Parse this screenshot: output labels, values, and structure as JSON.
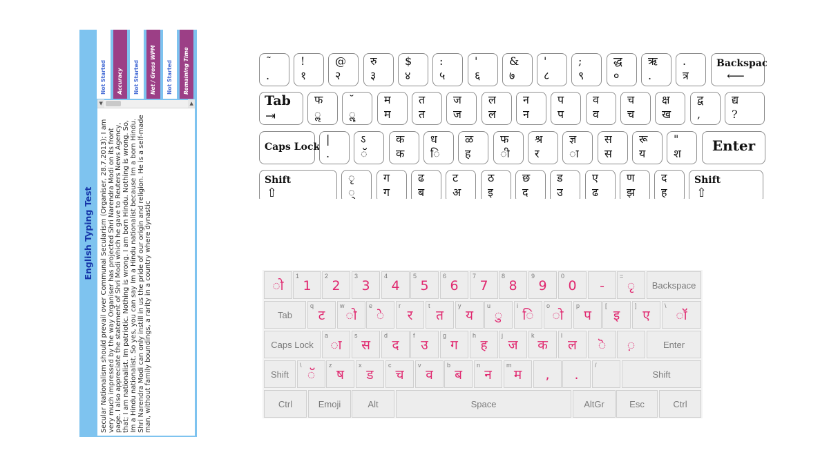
{
  "typing_test": {
    "title": "English Typing Test",
    "passage": "Secular Nationalism should prevail over Communal Secularism (Organiser, 28.7.2013); I am very much impressed by the way Organiser has projected Shri Narendra Modi on its front page. I also appreciate the statement of Shri Modi which he gave to Reuters News Agency, that; I am nationalist. Im patriotic. Nothing is wrong. I am born Hindu. Nothing is wrong. So, Im a Hindu nationalist. So yes, you can say Im a Hindu nationalist because Im a born Hindu. Shri Narendra Modi can only instill in us the pride of our origin and religion. He is a self-made man, without family boundings, a rarity in a country where dynastic",
    "stats": [
      {
        "label": "Remaining Time",
        "value": "Not Started"
      },
      {
        "label": "Net / Gross WPM",
        "value": "Not Started"
      },
      {
        "label": "Accuracy",
        "value": "Not Started"
      }
    ]
  },
  "keyboard_kruti": {
    "rows": [
      [
        {
          "top": "˜",
          "bottom": "."
        },
        {
          "top": "!",
          "bottom": "१"
        },
        {
          "top": "@",
          "bottom": "२"
        },
        {
          "top": "रु",
          "bottom": "३"
        },
        {
          "top": "$",
          "bottom": "४"
        },
        {
          "top": ":",
          "bottom": "५"
        },
        {
          "top": "'",
          "bottom": "६"
        },
        {
          "top": "&",
          "bottom": "७"
        },
        {
          "top": "'",
          "bottom": "८"
        },
        {
          "top": ";",
          "bottom": "९"
        },
        {
          "top": "द्ध",
          "bottom": "०"
        },
        {
          "top": "ऋ",
          "bottom": "."
        },
        {
          "top": ".",
          "bottom": "त्र"
        },
        {
          "word": "Backspace"
        }
      ],
      [
        {
          "word": "Tab"
        },
        {
          "top": "फ",
          "bottom": "ॢ"
        },
        {
          "top": "˘",
          "bottom": "ॣ"
        },
        {
          "top": "म",
          "bottom": "म"
        },
        {
          "top": "त",
          "bottom": "त"
        },
        {
          "top": "ज",
          "bottom": "ज"
        },
        {
          "top": "ल",
          "bottom": "ल"
        },
        {
          "top": "न",
          "bottom": "न"
        },
        {
          "top": "प",
          "bottom": "प"
        },
        {
          "top": "व",
          "bottom": "व"
        },
        {
          "top": "च",
          "bottom": "च"
        },
        {
          "top": "क्ष",
          "bottom": "ख"
        },
        {
          "top": "द्व",
          "bottom": ","
        },
        {
          "top": "द्य",
          "bottom": "?"
        }
      ],
      [
        {
          "word": "Caps Lock"
        },
        {
          "top": "|",
          "bottom": "."
        },
        {
          "top": "ऽ",
          "bottom": "ॅ"
        },
        {
          "top": "क",
          "bottom": "क"
        },
        {
          "top": "ध",
          "bottom": "ि"
        },
        {
          "top": "ळ",
          "bottom": "ह"
        },
        {
          "top": "फ",
          "bottom": "ी"
        },
        {
          "top": "श्र",
          "bottom": "र"
        },
        {
          "top": "ज्ञ",
          "bottom": "ा"
        },
        {
          "top": "स",
          "bottom": "स"
        },
        {
          "top": "रू",
          "bottom": "य"
        },
        {
          "top": "\"",
          "bottom": "श"
        },
        {
          "word": "Enter"
        }
      ],
      [
        {
          "word": "Shift"
        },
        {
          "top": "ृ",
          "bottom": "्"
        },
        {
          "top": "ग",
          "bottom": "ग"
        },
        {
          "top": "ढ",
          "bottom": "ब"
        },
        {
          "top": "ट",
          "bottom": "अ"
        },
        {
          "top": "ठ",
          "bottom": "इ"
        },
        {
          "top": "छ",
          "bottom": "द"
        },
        {
          "top": "ड",
          "bottom": "उ"
        },
        {
          "top": "ए",
          "bottom": "ढ"
        },
        {
          "top": "ण",
          "bottom": "झ"
        },
        {
          "top": "द",
          "bottom": "ह"
        },
        {
          "word": "Shift"
        }
      ]
    ]
  },
  "keyboard_osk": {
    "rows": [
      [
        {
          "s": "",
          "m": "ो"
        },
        {
          "s": "1",
          "m": "1"
        },
        {
          "s": "2",
          "m": "2"
        },
        {
          "s": "3",
          "m": "3"
        },
        {
          "s": "4",
          "m": "4"
        },
        {
          "s": "5",
          "m": "5"
        },
        {
          "s": "6",
          "m": "6"
        },
        {
          "s": "7",
          "m": "7"
        },
        {
          "s": "8",
          "m": "8"
        },
        {
          "s": "9",
          "m": "9"
        },
        {
          "s": "0",
          "m": "0"
        },
        {
          "s": "",
          "m": "-"
        },
        {
          "s": "=",
          "m": "ृ"
        },
        {
          "label": "Backspace"
        }
      ],
      [
        {
          "label": "Tab"
        },
        {
          "s": "q",
          "m": "ट"
        },
        {
          "s": "w",
          "m": "ो"
        },
        {
          "s": "e",
          "m": "े"
        },
        {
          "s": "r",
          "m": "र"
        },
        {
          "s": "t",
          "m": "त"
        },
        {
          "s": "y",
          "m": "य"
        },
        {
          "s": "u",
          "m": "ु"
        },
        {
          "s": "i",
          "m": "ि"
        },
        {
          "s": "o",
          "m": "ो"
        },
        {
          "s": "p",
          "m": "प"
        },
        {
          "s": "[",
          "m": "इ"
        },
        {
          "s": "]",
          "m": "ए"
        },
        {
          "s": "\\",
          "m": "ॉ"
        }
      ],
      [
        {
          "label": "Caps Lock"
        },
        {
          "s": "a",
          "m": "ा"
        },
        {
          "s": "s",
          "m": "स"
        },
        {
          "s": "d",
          "m": "द"
        },
        {
          "s": "f",
          "m": "उ"
        },
        {
          "s": "g",
          "m": "ग"
        },
        {
          "s": "h",
          "m": "ह"
        },
        {
          "s": "j",
          "m": "ज"
        },
        {
          "s": "k",
          "m": "क"
        },
        {
          "s": "l",
          "m": "ल"
        },
        {
          "s": "",
          "m": "ॆ"
        },
        {
          "s": "",
          "m": "़"
        },
        {
          "label": "Enter"
        }
      ],
      [
        {
          "label": "Shift"
        },
        {
          "s": "\\",
          "m": "ॅ"
        },
        {
          "s": "z",
          "m": "ष"
        },
        {
          "s": "x",
          "m": "ड"
        },
        {
          "s": "c",
          "m": "च"
        },
        {
          "s": "v",
          "m": "व"
        },
        {
          "s": "b",
          "m": "ब"
        },
        {
          "s": "n",
          "m": "न"
        },
        {
          "s": "m",
          "m": "म"
        },
        {
          "s": "",
          "m": ","
        },
        {
          "s": "",
          "m": "."
        },
        {
          "s": "/",
          "m": ""
        },
        {
          "label": "Shift"
        }
      ],
      [
        {
          "label": "Ctrl"
        },
        {
          "label": "Emoji"
        },
        {
          "label": "Alt"
        },
        {
          "label": "Space"
        },
        {
          "label": "AltGr"
        },
        {
          "label": "Esc"
        },
        {
          "label": "Ctrl"
        }
      ]
    ]
  }
}
